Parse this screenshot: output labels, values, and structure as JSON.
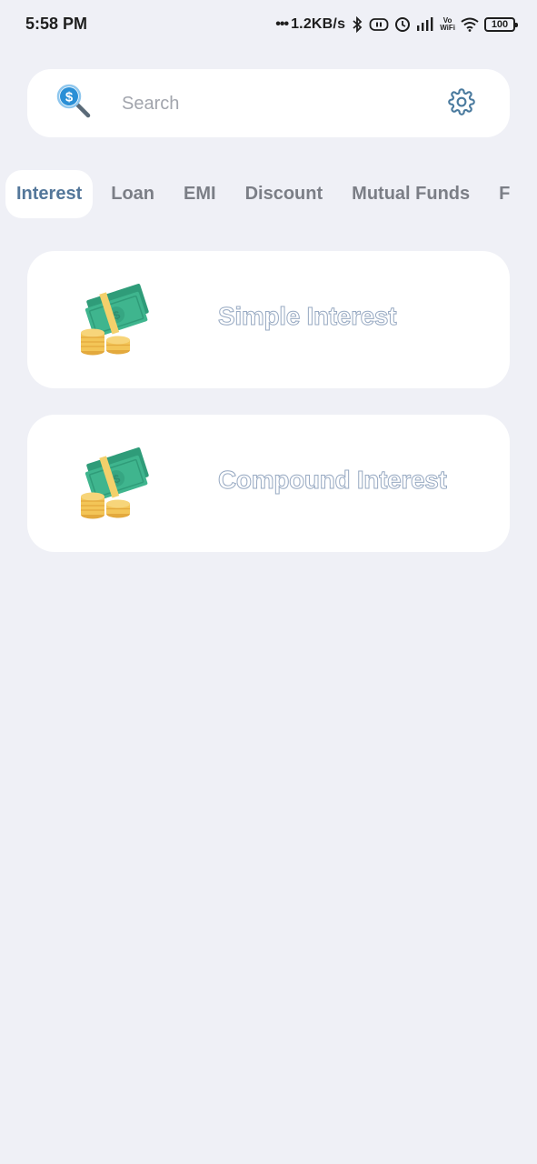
{
  "status_bar": {
    "time": "5:58 PM",
    "dots": "•••",
    "net_speed": "1.2KB/s",
    "vowifi_top": "Vo",
    "vowifi_bottom": "WiFi",
    "battery": "100",
    "icons": [
      "bluetooth-icon",
      "vibrate-icon",
      "alarm-icon",
      "signal-icon",
      "vowifi-icon",
      "wifi-icon",
      "battery-icon"
    ]
  },
  "search": {
    "placeholder": "Search",
    "value": "",
    "logo_icon": "dollar-search-icon",
    "settings_icon": "gear-icon"
  },
  "tabs": [
    "Interest",
    "Loan",
    "EMI",
    "Discount",
    "Mutual Funds",
    "F"
  ],
  "active_tab": "Interest",
  "cards": [
    {
      "title": "Simple Interest",
      "icon": "money-cash-coins-icon"
    },
    {
      "title": "Compound Interest",
      "icon": "money-cash-coins-icon"
    }
  ],
  "colors": {
    "background": "#eff0f6",
    "card": "#ffffff",
    "active_tab_text": "#54779a",
    "inactive_tab_text": "#7b7e86",
    "title_outline": "#97a9c2",
    "cash_green": "#3fb58e",
    "coin_yellow": "#f3c557",
    "logo_blue": "#2a8fd6"
  }
}
